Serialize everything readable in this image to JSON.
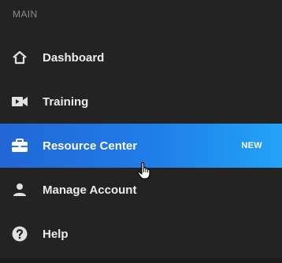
{
  "section": {
    "title": "MAIN"
  },
  "nav": {
    "items": [
      {
        "label": "Dashboard",
        "icon": "home-icon"
      },
      {
        "label": "Training",
        "icon": "video-camera-icon"
      },
      {
        "label": "Resource Center",
        "icon": "briefcase-icon",
        "badge": "NEW",
        "active": true
      },
      {
        "label": "Manage Account",
        "icon": "person-icon"
      },
      {
        "label": "Help",
        "icon": "help-circle-icon"
      }
    ]
  },
  "colors": {
    "background": "#232323",
    "active_gradient_start": "#2166d6",
    "active_gradient_end": "#22a3f7",
    "icon": "#e0e0e0"
  }
}
